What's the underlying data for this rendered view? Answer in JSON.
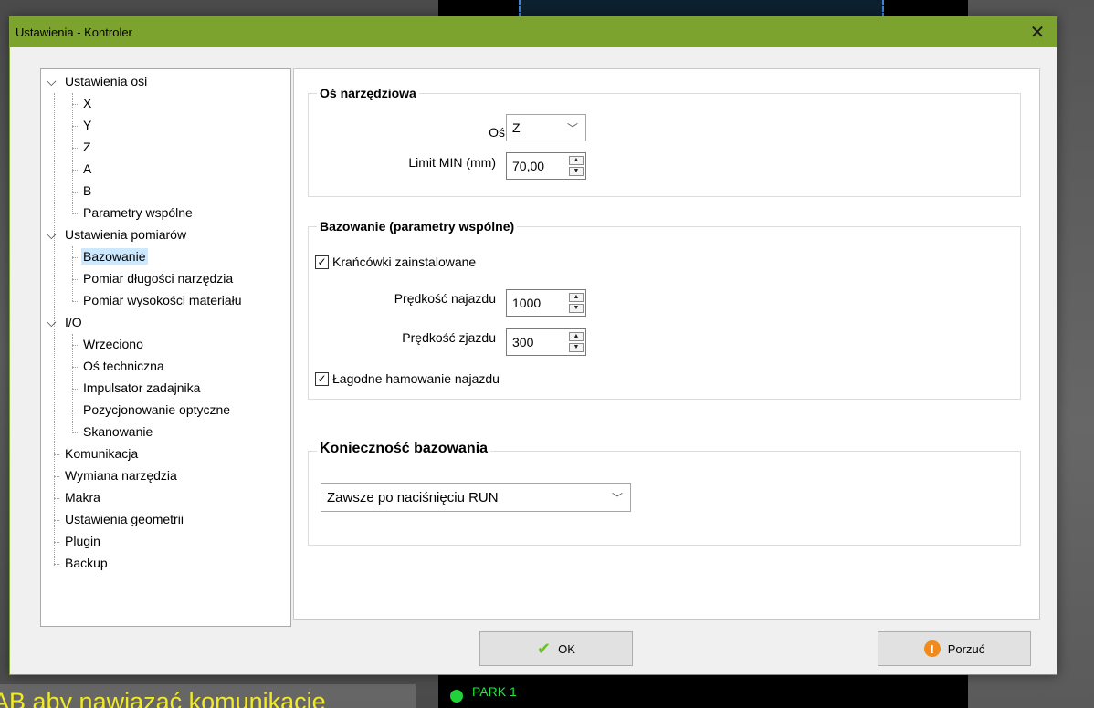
{
  "dialog": {
    "title": "Ustawienia - Kontroler",
    "close_icon": "close-icon"
  },
  "tree": {
    "items": [
      {
        "label": "Ustawienia osi",
        "level": 0,
        "expandable": true
      },
      {
        "label": "X",
        "level": 1
      },
      {
        "label": "Y",
        "level": 1
      },
      {
        "label": "Z",
        "level": 1
      },
      {
        "label": "A",
        "level": 1
      },
      {
        "label": "B",
        "level": 1
      },
      {
        "label": "Parametry wspólne",
        "level": 1
      },
      {
        "label": "Ustawienia pomiarów",
        "level": 0,
        "expandable": true
      },
      {
        "label": "Bazowanie",
        "level": 1,
        "selected": true
      },
      {
        "label": "Pomiar długości narzędzia",
        "level": 1
      },
      {
        "label": "Pomiar wysokości materiału",
        "level": 1
      },
      {
        "label": "I/O",
        "level": 0,
        "expandable": true
      },
      {
        "label": "Wrzeciono",
        "level": 1
      },
      {
        "label": "Oś techniczna",
        "level": 1
      },
      {
        "label": "Impulsator zadajnika",
        "level": 1
      },
      {
        "label": "Pozycjonowanie optyczne",
        "level": 1
      },
      {
        "label": "Skanowanie",
        "level": 1
      },
      {
        "label": "Komunikacja",
        "level": 0
      },
      {
        "label": "Wymiana narzędzia",
        "level": 0
      },
      {
        "label": "Makra",
        "level": 0
      },
      {
        "label": "Ustawienia geometrii",
        "level": 0
      },
      {
        "label": "Plugin",
        "level": 0
      },
      {
        "label": "Backup",
        "level": 0
      }
    ]
  },
  "tool_axis": {
    "title": "Oś narzędziowa",
    "axis_label": "Oś",
    "axis_value": "Z",
    "limit_label": "Limit MIN (mm)",
    "limit_value": "70,00"
  },
  "homing": {
    "title": "Bazowanie (parametry wspólne)",
    "limit_switches_label": "Krańcówki  zainstalowane",
    "limit_switches_checked": true,
    "approach_speed_label": "Prędkość najazdu",
    "approach_speed_value": "1000",
    "retract_speed_label": "Prędkość zjazdu",
    "retract_speed_value": "300",
    "soft_braking_label": "Łagodne hamowanie najazdu",
    "soft_braking_checked": true
  },
  "homing_required": {
    "title": "Konieczność bazowania",
    "value": "Zawsze po  naciśnięciu RUN"
  },
  "buttons": {
    "ok_label": "OK",
    "cancel_label": "Porzuć"
  },
  "background": {
    "status_text": "AB aby nawiązać komunikację",
    "park_label": "PARK 1"
  },
  "colors": {
    "titlebar": "#7da32f",
    "selection": "#cce8ff",
    "status_text": "#f1ea26",
    "park": "#27e442"
  }
}
